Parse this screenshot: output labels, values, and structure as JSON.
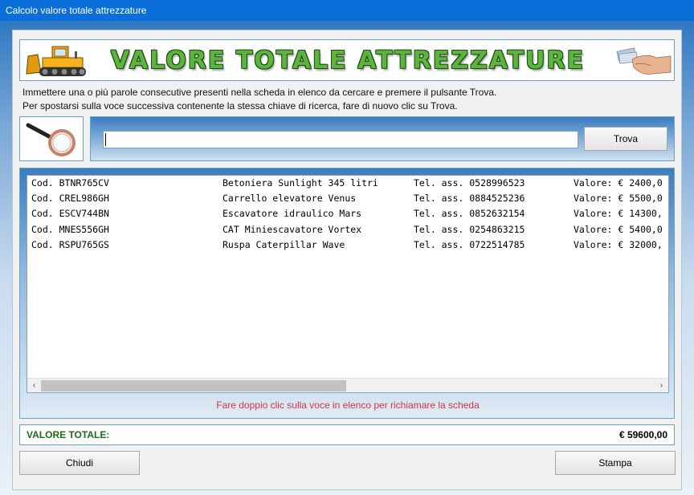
{
  "window": {
    "title": "Calcolo valore totale attrezzature"
  },
  "banner": {
    "title": "VALORE TOTALE ATTREZZATURE"
  },
  "instructions": {
    "line1": "Immettere una o più parole consecutive presenti nella scheda in elenco da cercare e premere il pulsante Trova.",
    "line2": "Per spostarsi sulla voce successiva contenente la stessa chiave di ricerca, fare di nuovo clic su Trova."
  },
  "search": {
    "value": "",
    "placeholder": "",
    "button_label": "Trova"
  },
  "list": {
    "rows": [
      {
        "code": "Cod. BTNR765CV",
        "name": "Betoniera Sunlight 345 litri",
        "phone": "Tel. ass. 0528996523",
        "value": "Valore: € 2400,0"
      },
      {
        "code": "Cod. CREL986GH",
        "name": "Carrello elevatore Venus",
        "phone": "Tel. ass. 0884525236",
        "value": "Valore: € 5500,0"
      },
      {
        "code": "Cod. ESCV744BN",
        "name": "Escavatore idraulico Mars",
        "phone": "Tel. ass. 0852632154",
        "value": "Valore: € 14300,"
      },
      {
        "code": "Cod. MNES556GH",
        "name": "CAT Miniescavatore Vortex",
        "phone": "Tel. ass. 0254863215",
        "value": "Valore: € 5400,0"
      },
      {
        "code": "Cod. RSPU765GS",
        "name": "Ruspa Caterpillar Wave",
        "phone": "Tel. ass. 0722514785",
        "value": "Valore: € 32000,"
      }
    ],
    "hint": "Fare doppio clic sulla voce in elenco per richiamare la scheda"
  },
  "total": {
    "label": "VALORE TOTALE:",
    "value": "€ 59600,00"
  },
  "buttons": {
    "close": "Chiudi",
    "print": "Stampa"
  },
  "icons": {
    "bulldozer": "bulldozer-icon",
    "money_hand": "money-hand-icon",
    "magnifier": "magnifier-icon",
    "scroll_left": "‹",
    "scroll_right": "›"
  },
  "colors": {
    "titlebar": "#0a6fd8",
    "banner_text": "#5cb33d",
    "total_label": "#1e6a1b",
    "hint": "#d2334a"
  }
}
